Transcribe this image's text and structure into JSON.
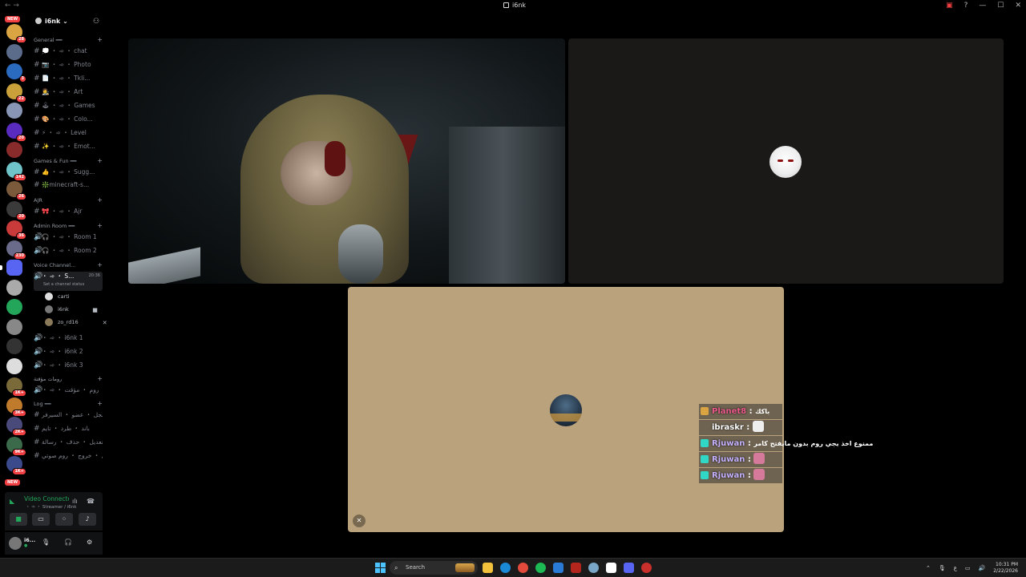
{
  "window": {
    "title": "i6nk"
  },
  "server_rail": {
    "new_top": "NEW",
    "new_bottom": "NEW",
    "servers": [
      {
        "name": "server-1",
        "badge": "28",
        "color": "#d9a441"
      },
      {
        "name": "server-2",
        "badge": "",
        "color": "#5b6b8a"
      },
      {
        "name": "server-3",
        "badge": "3",
        "color": "#2a6bbf"
      },
      {
        "name": "server-4",
        "badge": "22",
        "color": "#c9a03a"
      },
      {
        "name": "server-5",
        "badge": "",
        "color": "#8895b5"
      },
      {
        "name": "server-6",
        "badge": "20",
        "color": "#5a2bbf"
      },
      {
        "name": "server-7",
        "badge": "",
        "color": "#8a2b2b"
      },
      {
        "name": "server-8",
        "badge": "142",
        "color": "#6ec4c9"
      },
      {
        "name": "server-9",
        "badge": "26",
        "color": "#7a5a3a"
      },
      {
        "name": "server-10",
        "badge": "20",
        "color": "#3a3a3a"
      },
      {
        "name": "server-11",
        "badge": "36",
        "color": "#c93a3a"
      },
      {
        "name": "server-12",
        "badge": "230",
        "color": "#6a6a8a"
      },
      {
        "name": "server-13",
        "badge": "",
        "color": "#5865f2"
      },
      {
        "name": "server-14",
        "badge": "",
        "color": "#aaaaaa"
      },
      {
        "name": "server-15",
        "badge": "",
        "color": "#23a55a"
      },
      {
        "name": "server-16",
        "badge": "",
        "color": "#888888"
      },
      {
        "name": "server-17",
        "badge": "",
        "color": "#333333"
      },
      {
        "name": "server-18",
        "badge": "",
        "color": "#dddddd"
      },
      {
        "name": "server-19",
        "badge": "1K+",
        "color": "#7a6a3a"
      },
      {
        "name": "server-20",
        "badge": "3K+",
        "color": "#bf7a2b"
      },
      {
        "name": "server-21",
        "badge": "2K+",
        "color": "#4a4a7a"
      },
      {
        "name": "server-22",
        "badge": "9K+",
        "color": "#3a6a4a"
      },
      {
        "name": "server-23",
        "badge": "1K+",
        "color": "#3a4a8a"
      }
    ]
  },
  "guild": {
    "name": "i6nk",
    "categories": [
      {
        "label": "General ━━",
        "channels": [
          "💭 ・ ➾ ・ chat",
          "📷 ・ ➾ ・ Photo",
          "📄 ・ ➾ ・ Tkli...",
          "👩‍🎨 ・ ➾ ・ Art",
          "🕹 ・ ➾ ・ Games",
          "🎨 ・ ➾ ・ Colo...",
          "⚡ ・ ➾ ・ Level",
          "✨ ・ ➾ ・ Emot..."
        ]
      },
      {
        "label": "Games & Fun ━━",
        "channels": [
          "👍 ・ ➾ ・ Sugg...",
          "❇️minecraft-s..."
        ]
      },
      {
        "label": "AJR",
        "channels": [
          "🎀 ・ ➾ ・ Ajr"
        ]
      },
      {
        "label": "Admin Room ━━",
        "voice": [
          "🎧 ・ ➾ ・ Room 1",
          "🎧 ・ ➾ ・ Room 2"
        ]
      }
    ],
    "voice_category": "Voice Channel...",
    "active_voice": {
      "label": "・ ➾ ・ S...",
      "time": "20:36",
      "status": "Set a channel status"
    },
    "members": [
      {
        "name": "carti",
        "color": "#dddddd"
      },
      {
        "name": "i6nk",
        "color": "#777777"
      },
      {
        "name": "zo_rd16",
        "color": "#8a7a5a"
      }
    ],
    "voice_rooms": [
      "・ ➾ ・ i6nk 1",
      "・ ➾ ・ i6nk 2",
      "・ ➾ ・ i6nk 3"
    ],
    "temp_category": "رومات مؤقتة",
    "temp_room": "・ ➾ ・ روم ・ مؤقت",
    "log_category": "Log ━━",
    "log_channels": [
      "سجل ・ عضو ・ السيرفر",
      "باند ・ طرد ・ تايم",
      "تعديل ・ حذف ・ رسالة",
      "دخول ・ خروج ・ روم صوتي"
    ]
  },
  "voice_panel": {
    "connected": "Video Connected",
    "server": "・ ➾ ・ Streamer / i6nk"
  },
  "user": {
    "name": "i6...",
    "status": "●"
  },
  "chat_overlay": [
    {
      "user": "Planet8",
      "color": "#e85a8a",
      "icon": "#d9a441",
      "text": "باكك",
      "emote": false
    },
    {
      "user": "ibraskr",
      "color": "#ffffff",
      "icon": "",
      "text": "",
      "emote": true,
      "emote_color": "#eeeeee"
    },
    {
      "user": "Rjuwan",
      "color": "#c5b2ff",
      "icon": "#2fd7c4",
      "text": "ممنوع اخذ يجي روم بدون مايفتح كامر",
      "emote": false
    },
    {
      "user": "Rjuwan",
      "color": "#c5b2ff",
      "icon": "#2fd7c4",
      "text": "",
      "emote": true,
      "emote_color": "#d57a9a"
    },
    {
      "user": "Rjuwan",
      "color": "#c5b2ff",
      "icon": "#2fd7c4",
      "text": "",
      "emote": true,
      "emote_color": "#d57a9a"
    }
  ],
  "taskbar": {
    "search_label": "Search",
    "time": "10:31 PM",
    "date": "2/22/2026"
  }
}
